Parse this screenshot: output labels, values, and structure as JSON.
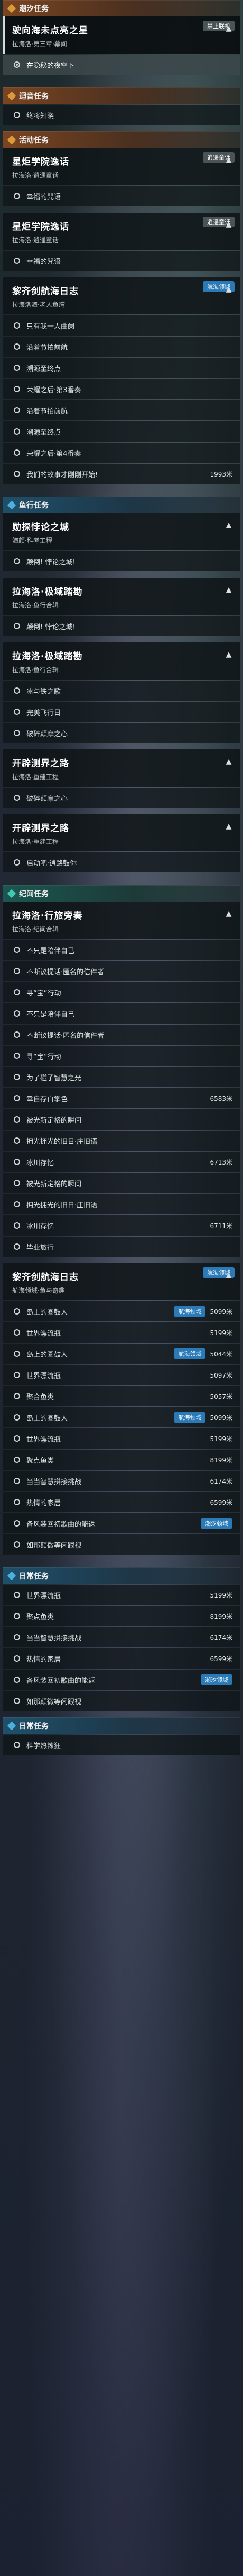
{
  "sections": [
    {
      "header": "潮汐任务",
      "tone": "orange",
      "quests": [
        {
          "title": "驶向海未点亮之星",
          "subtitle": "拉海洛·第三章·幕间",
          "badge": "禁止联机",
          "badge_tone": "grey",
          "steps": [
            {
              "label": "在隐秘的夜空下",
              "selected": true
            }
          ]
        }
      ]
    },
    {
      "header": "迴音任务",
      "tone": "orange",
      "quests": [],
      "steps": [
        {
          "label": "终将知晓"
        }
      ]
    },
    {
      "header": "活动任务",
      "tone": "orange",
      "quests": [
        {
          "title": "星炬学院逸话",
          "subtitle": "拉海洛·逍遥童话",
          "badge": "逍遥童话",
          "badge_tone": "grey",
          "steps": [
            {
              "label": "幸福的咒语"
            }
          ]
        },
        {
          "title": "星炬学院逸话",
          "subtitle": "拉海洛·逍遥童话",
          "badge": "逍遥童话",
          "badge_tone": "grey",
          "steps": [
            {
              "label": "幸福的咒语"
            }
          ]
        },
        {
          "title": "黎齐剑航海日志",
          "subtitle": "拉海洛海·老人鱼湾",
          "badge": "航海领域",
          "badge_tone": "blue",
          "steps": [
            {
              "label": "只有我一人曲阑"
            },
            {
              "label": "沿着节拍前航"
            },
            {
              "label": "溯源至终点"
            },
            {
              "label": "荣耀之后·第3番奏"
            },
            {
              "label": "沿着节拍前航"
            },
            {
              "label": "溯源至终点"
            },
            {
              "label": "荣耀之后·第4番奏"
            },
            {
              "label": "我们的故事才刚刚开始!",
              "count": "1993米"
            }
          ]
        }
      ]
    },
    {
      "header": "鱼行任务",
      "tone": "blue",
      "quests": [
        {
          "title": "勋探悖论之城",
          "subtitle": "海颜·科考工程",
          "steps": [
            {
              "label": "颠倒! 悖论之城!"
            }
          ]
        },
        {
          "title": "拉海洛·极域踏勘",
          "subtitle": "拉海洛·鱼行合辑",
          "steps": [
            {
              "label": "颠倒! 悖论之城!"
            }
          ]
        },
        {
          "title": "拉海洛·极域踏勘",
          "subtitle": "拉海洛·鱼行合辑",
          "steps": [
            {
              "label": "冰与铁之歌"
            },
            {
              "label": "完美飞行日"
            },
            {
              "label": "破碎颠摩之心"
            }
          ]
        },
        {
          "title": "开辟测界之路",
          "subtitle": "拉海洛·重建工程",
          "steps": [
            {
              "label": "破碎颠摩之心"
            }
          ]
        },
        {
          "title": "开辟测界之路",
          "subtitle": "拉海洛·重建工程",
          "steps": [
            {
              "label": "启动吧·逍路鼓你"
            }
          ]
        }
      ]
    },
    {
      "header": "纪闻任务",
      "tone": "teal",
      "quests": [
        {
          "title": "拉海洛·行旅旁奏",
          "subtitle": "拉海洛·纪闻合辑",
          "steps": [
            {
              "label": "不只是陪伴自己"
            },
            {
              "label": "不断议提话·匿名的信件者"
            },
            {
              "label": "寻“宝”行动"
            },
            {
              "label": "不只是陪伴自己"
            },
            {
              "label": "不断议提话·匿名的信件者"
            },
            {
              "label": "寻“宝”行动"
            },
            {
              "label": "为了碰子智慧之光"
            },
            {
              "label": "幸自存白掌色",
              "count": "6583米"
            },
            {
              "label": "被光新定格的瞬间"
            },
            {
              "label": "拥光拥光的旧日·庄旧语"
            },
            {
              "label": "冰川存忆",
              "count": "6713米"
            },
            {
              "label": "被光新定格的瞬间"
            },
            {
              "label": "拥光拥光的旧日·庄旧语"
            },
            {
              "label": "冰川存忆",
              "count": "6711米"
            },
            {
              "label": "毕业旅行"
            }
          ]
        },
        {
          "title": "黎齐剑航海日志",
          "subtitle": "航海领域·鱼与奇趣",
          "badge": "航海领域",
          "badge_tone": "blue",
          "steps": [
            {
              "label": "岛上的圈鼓人",
              "count": "5099米",
              "badge": "航海领域"
            },
            {
              "label": "世界漂流瓶",
              "count": "5199米"
            },
            {
              "label": "岛上的圈鼓人",
              "count": "5044米",
              "badge": "航海领域"
            },
            {
              "label": "世界漂流瓶",
              "count": "5097米"
            },
            {
              "label": "聚合鱼类",
              "count": "5057米"
            },
            {
              "label": "岛上的圈鼓人",
              "count": "5099米",
              "badge": "航海领域"
            },
            {
              "label": "世界漂流瓶",
              "count": "5199米"
            },
            {
              "label": "聚点鱼类",
              "count": "8199米"
            },
            {
              "label": "当当智慧拼接挑战",
              "count": "6174米"
            },
            {
              "label": "热情的家居",
              "count": "6599米"
            },
            {
              "label": "备风装回初歌曲的能返",
              "badge": "潮汐领域"
            },
            {
              "label": "如那颠微等闲跟视"
            }
          ]
        }
      ]
    },
    {
      "header": "日常任务",
      "tone": "blue",
      "quests": [],
      "steps": [
        {
          "label": "世界漂流瓶",
          "count": "5199米"
        },
        {
          "label": "聚点鱼类",
          "count": "8199米"
        },
        {
          "label": "当当智慧拼接挑战",
          "count": "6174米"
        },
        {
          "label": "热情的家居",
          "count": "6599米"
        },
        {
          "label": "备风装回初歌曲的能返",
          "badge": "潮汐领域"
        },
        {
          "label": "如那颠微等闲跟视"
        }
      ]
    },
    {
      "header": "日常任务",
      "tone": "blue",
      "quests": [],
      "steps": [
        {
          "label": "科学热辣狂"
        }
      ]
    }
  ]
}
